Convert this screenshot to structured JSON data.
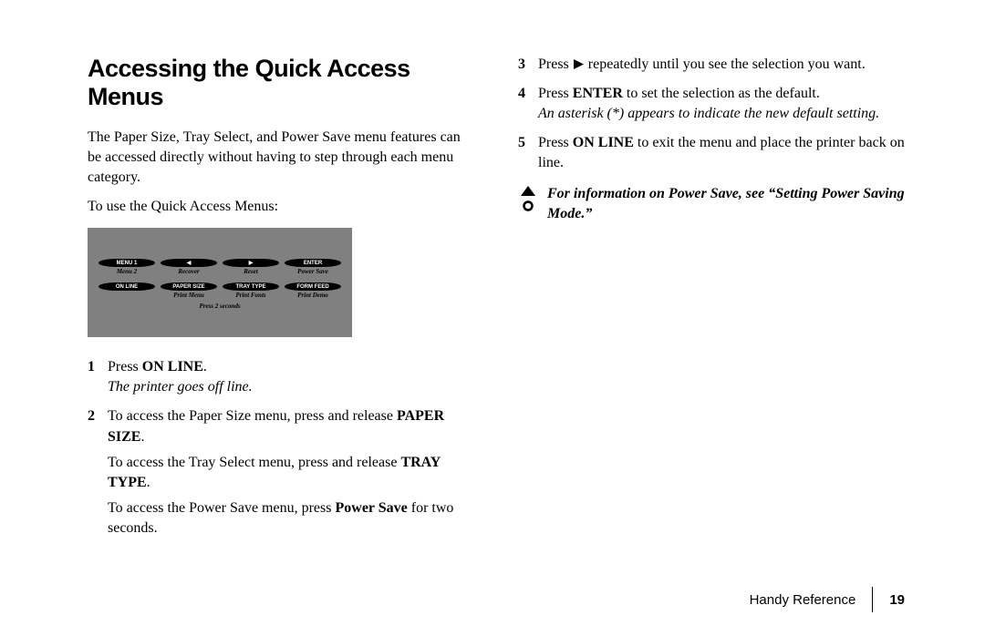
{
  "title": "Accessing the Quick Access Menus",
  "intro": "The Paper Size, Tray Select, and Power Save menu features can be accessed directly without having to step through each menu category.",
  "lead": "To use the Quick Access Menus:",
  "panel": {
    "row1": [
      {
        "top": "MENU 1",
        "sub": "Menu 2"
      },
      {
        "top": "◀",
        "sub": "Recover"
      },
      {
        "top": "▶",
        "sub": "Reset"
      },
      {
        "top": "ENTER",
        "sub": "Power Save"
      }
    ],
    "row2": [
      {
        "top": "ON LINE",
        "sub": ""
      },
      {
        "top": "PAPER SIZE",
        "sub": "Print Menu"
      },
      {
        "top": "TRAY TYPE",
        "sub": "Print Fonts"
      },
      {
        "top": "FORM FEED",
        "sub": "Print Demo"
      }
    ],
    "note": "Press 2 seconds"
  },
  "steps_left": {
    "s1_a": "Press ",
    "s1_b": "ON LINE",
    "s1_c": ".",
    "s1_note": "The printer goes off line.",
    "s2_a": "To access the Paper Size menu, press and release ",
    "s2_b": "PAPER SIZE",
    "s2_c": ".",
    "s2_d": "To access the Tray Select menu, press and release ",
    "s2_e": "TRAY TYPE",
    "s2_f": ".",
    "s2_g": "To access the Power Save menu, press ",
    "s2_h": "Power Save",
    "s2_i": " for two seconds."
  },
  "steps_right": {
    "s3_a": "Press ",
    "s3_b": " repeatedly until you see the selection you want.",
    "s4_a": "Press ",
    "s4_b": "ENTER",
    "s4_c": " to set the selection as the default.",
    "s4_note": "An asterisk (*) appears to indicate the new default setting.",
    "s5_a": "Press ",
    "s5_b": "ON LINE",
    "s5_c": " to exit the menu and place the printer back on line."
  },
  "warn_note": "For information on Power Save, see “Setting Power Saving Mode.”",
  "footer_label": "Handy Reference",
  "footer_page": "19"
}
